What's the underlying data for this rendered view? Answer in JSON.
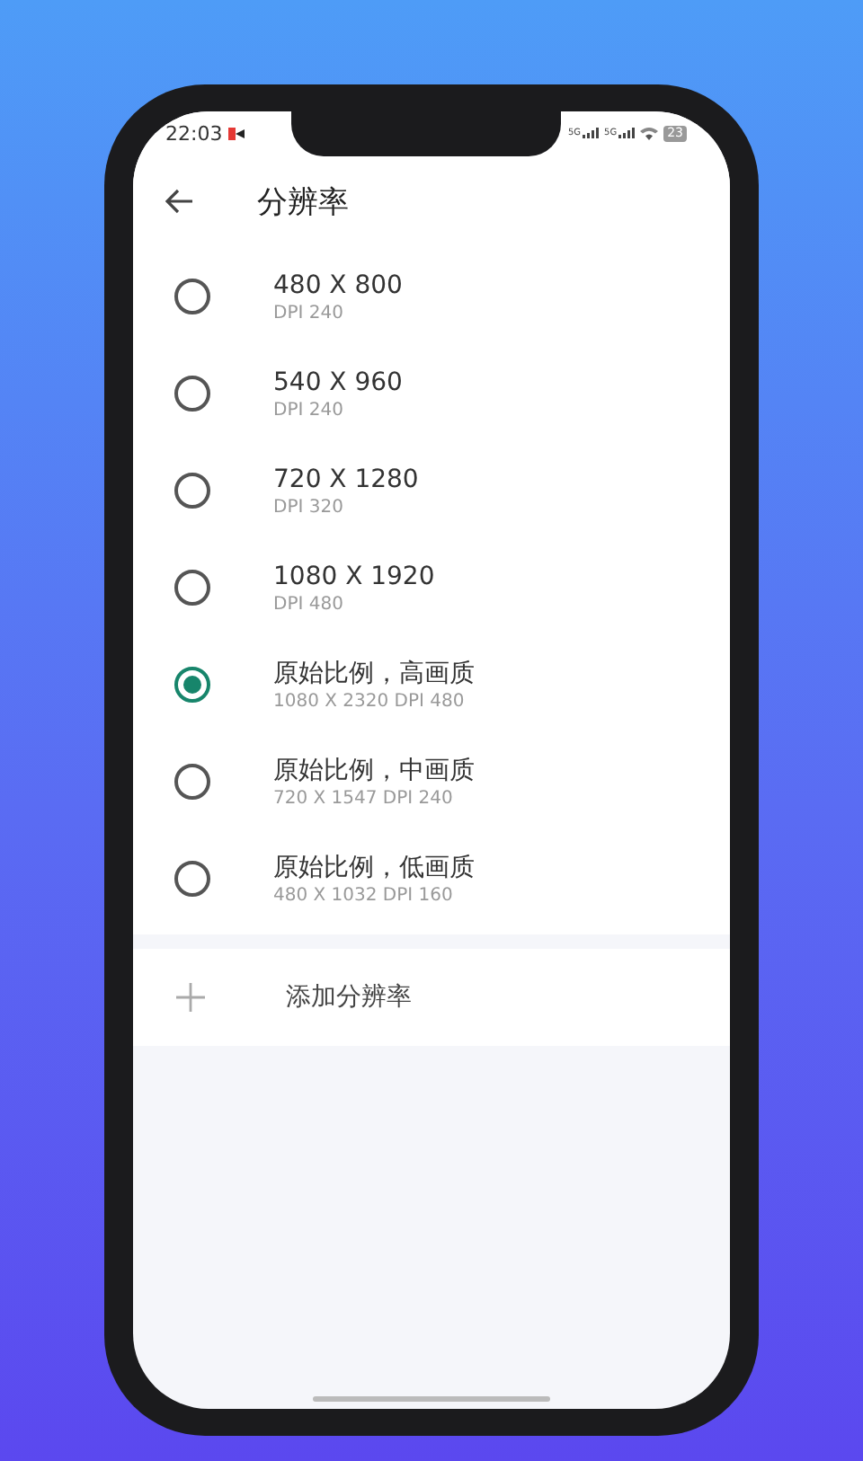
{
  "status_bar": {
    "time": "22:03",
    "signals": [
      "5G",
      "5G"
    ],
    "battery": "23"
  },
  "header": {
    "title": "分辨率"
  },
  "options": [
    {
      "label": "480 X 800",
      "detail": "DPI 240",
      "selected": false
    },
    {
      "label": "540 X 960",
      "detail": "DPI 240",
      "selected": false
    },
    {
      "label": "720 X 1280",
      "detail": "DPI 320",
      "selected": false
    },
    {
      "label": "1080 X 1920",
      "detail": "DPI 480",
      "selected": false
    },
    {
      "label": "原始比例，高画质",
      "detail": "1080 X 2320 DPI 480",
      "selected": true
    },
    {
      "label": "原始比例，中画质",
      "detail": "720 X 1547 DPI 240",
      "selected": false
    },
    {
      "label": "原始比例，低画质",
      "detail": "480 X 1032 DPI 160",
      "selected": false
    }
  ],
  "add_item": {
    "label": "添加分辨率"
  }
}
